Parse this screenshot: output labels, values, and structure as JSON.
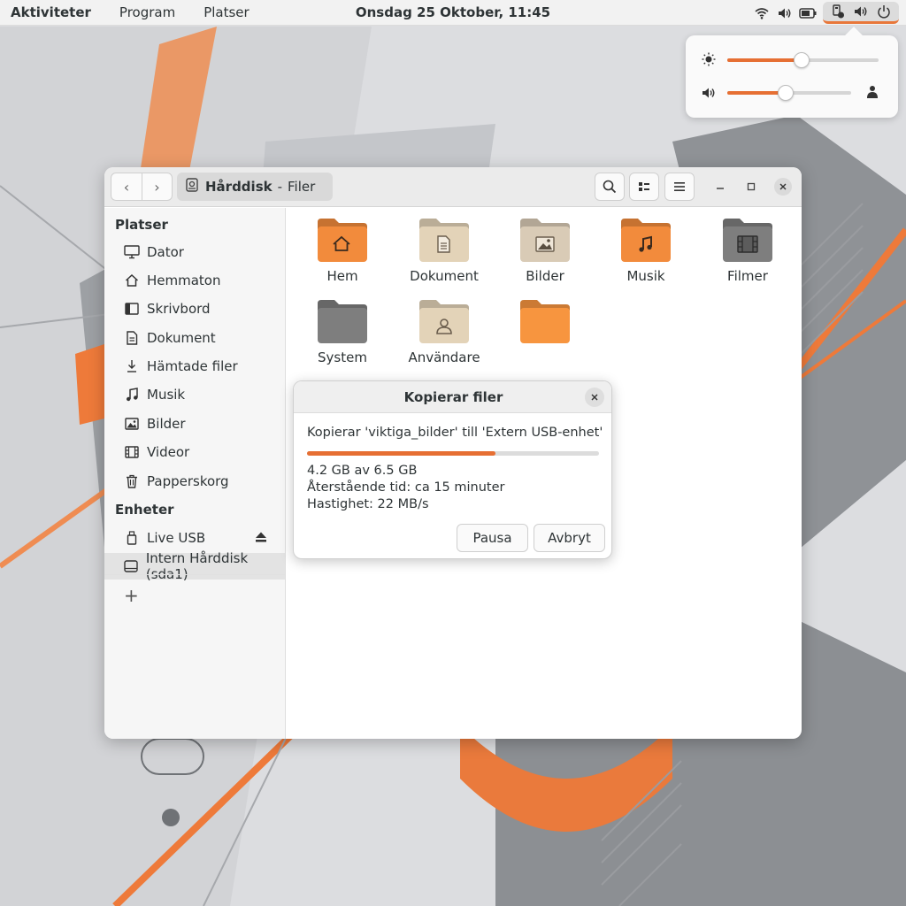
{
  "topbar": {
    "activities": "Aktiviteter",
    "programs": "Program",
    "places": "Platser",
    "clock": "Onsdag 25 Oktober, 11:45",
    "indicators": [
      "wifi-icon",
      "volume-icon",
      "battery-icon"
    ],
    "active_group": [
      "usb-drive-icon",
      "volume-icon",
      "power-icon"
    ],
    "accent_color": "#e8773a"
  },
  "quick_settings": {
    "brightness": {
      "icon": "brightness-icon",
      "level": 0.49
    },
    "volume": {
      "icon": "volume-icon",
      "level": 0.47,
      "output_icon": "headphones-icon"
    }
  },
  "window": {
    "path_name": "Hårddisk",
    "path_sep": "-",
    "app_name": "Filer",
    "sidebar": {
      "places_header": "Platser",
      "places": [
        {
          "label": "Dator",
          "icon": "computer-icon"
        },
        {
          "label": "Hemmaton",
          "icon": "home-icon"
        },
        {
          "label": "Skrivbord",
          "icon": "desktop-icon"
        },
        {
          "label": "Dokument",
          "icon": "document-icon"
        },
        {
          "label": "Hämtade filer",
          "icon": "download-icon"
        },
        {
          "label": "Musik",
          "icon": "music-icon"
        },
        {
          "label": "Bilder",
          "icon": "image-icon"
        },
        {
          "label": "Videor",
          "icon": "video-icon"
        },
        {
          "label": "Papperskorg",
          "icon": "trash-icon"
        }
      ],
      "devices_header": "Enheter",
      "devices": [
        {
          "label": "Live USB",
          "icon": "usb-icon"
        },
        {
          "label": "Intern Hårddisk (sda1)",
          "icon": "drive-icon",
          "active": true
        }
      ]
    },
    "folders": [
      {
        "label": "Hem",
        "icon": "home-icon",
        "color": "#f28b3c"
      },
      {
        "label": "Dokument",
        "icon": "document-icon",
        "color": "#e3d3b8"
      },
      {
        "label": "Bilder",
        "icon": "image-icon",
        "color": "#d9cbb6"
      },
      {
        "label": "Musik",
        "icon": "music-icon",
        "color": "#f28b3c"
      },
      {
        "label": "Filmer",
        "icon": "film-icon",
        "color": "#7e7e7e"
      },
      {
        "label": "System",
        "icon": "folder-icon",
        "color": "#7e7e7e"
      },
      {
        "label": "Användare",
        "icon": "user-icon",
        "color": "#e3d3b8"
      },
      {
        "label": "",
        "icon": "folder-icon",
        "color": "#f7953f"
      }
    ]
  },
  "dialog": {
    "title": "Kopierar filer",
    "message": "Kopierar 'viktiga_bilder' till 'Extern USB-enhet'",
    "progress": 0.646,
    "size": "4.2 GB av 6.5 GB",
    "remaining": "Återstående tid: ca 15 minuter",
    "speed": "Hastighet: 22 MB/s",
    "pause": "Pausa",
    "cancel": "Avbryt"
  }
}
